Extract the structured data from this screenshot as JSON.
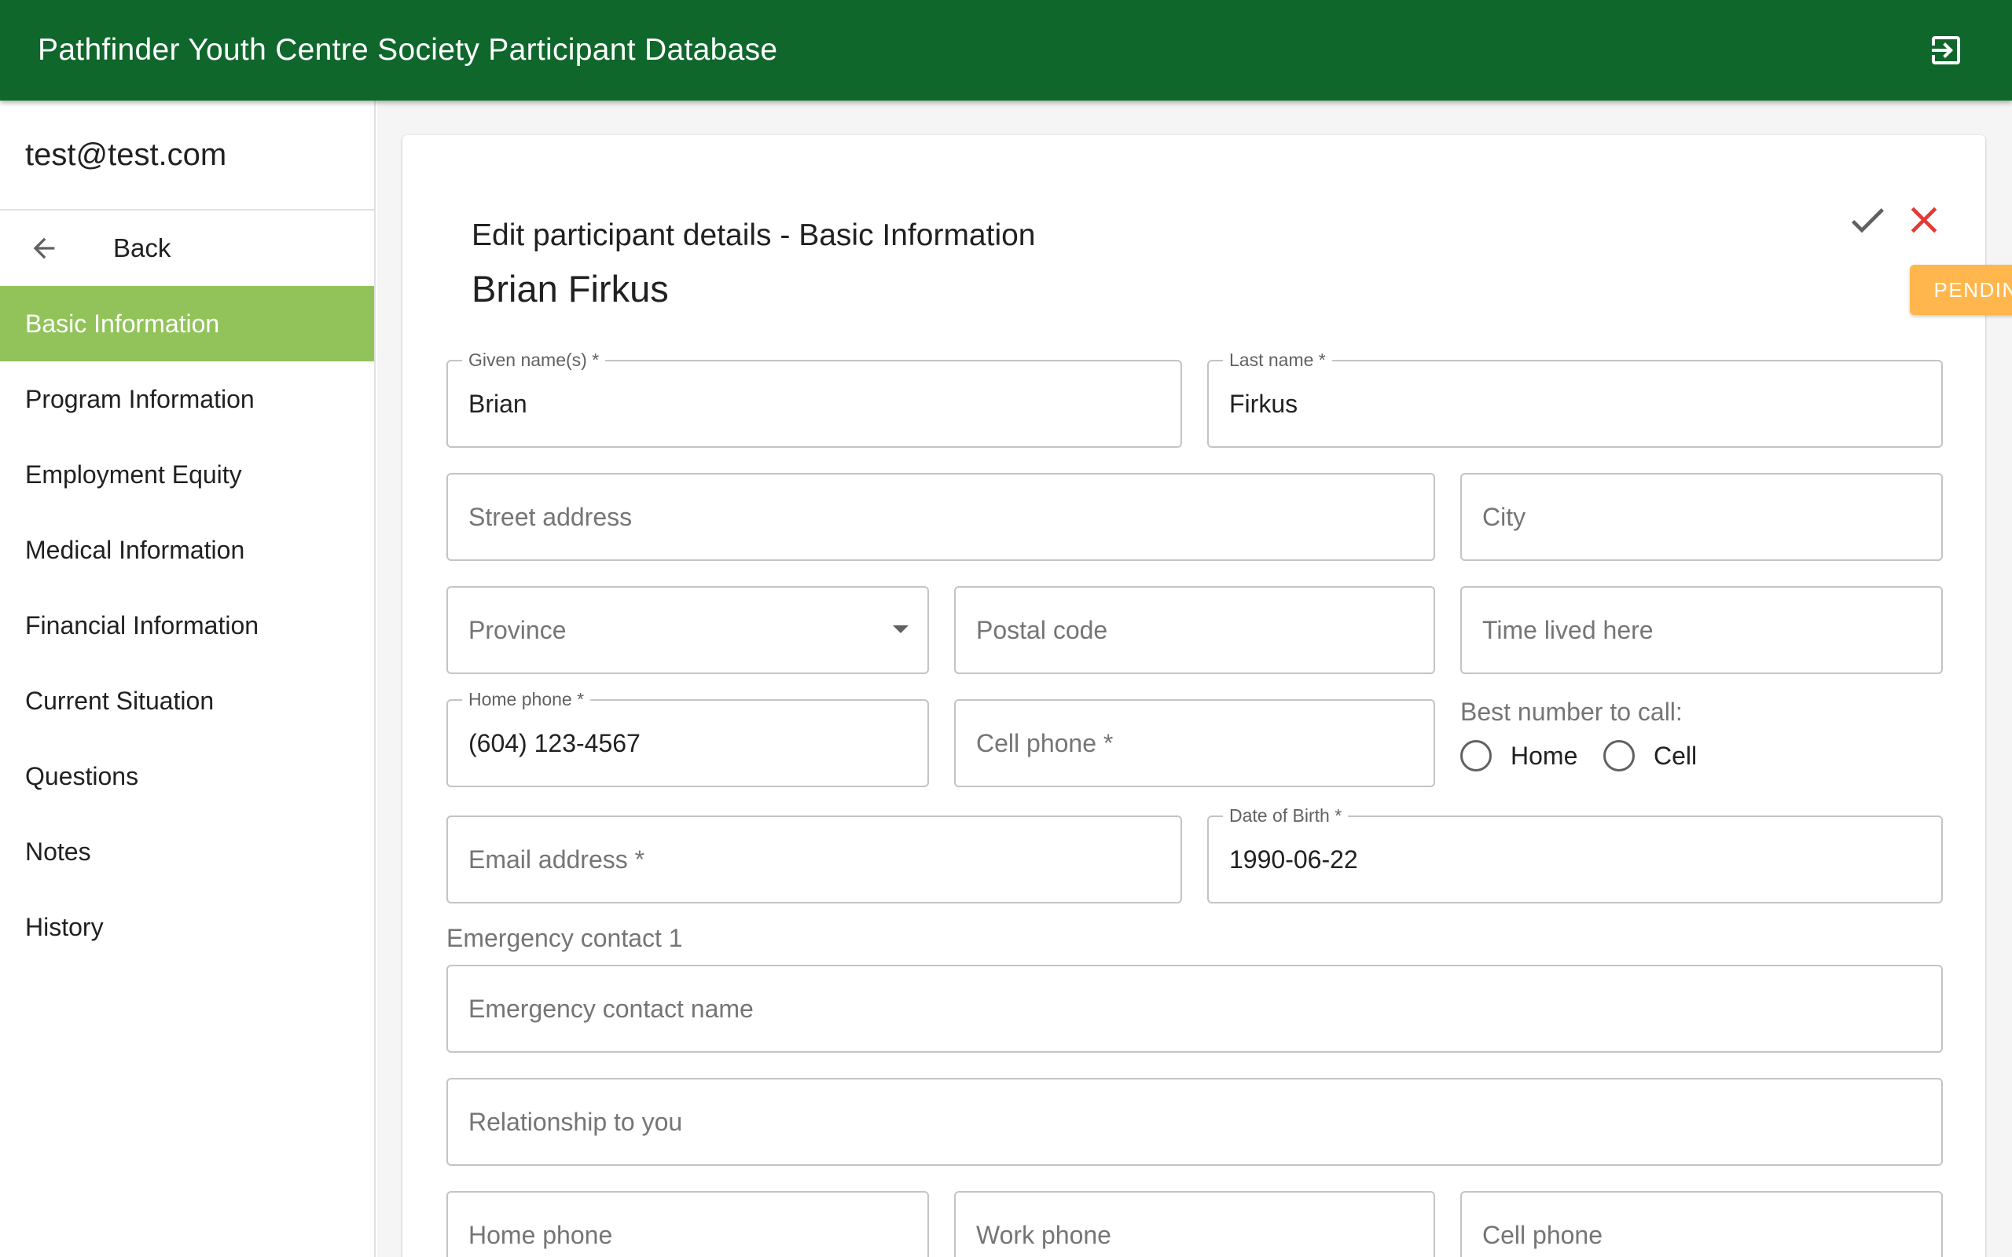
{
  "app": {
    "title": "Pathfinder Youth Centre Society Participant Database",
    "exit_icon": "exit-to-app-icon",
    "brand_color": "#0f672c"
  },
  "sidebar": {
    "user_email": "test@test.com",
    "back_label": "Back",
    "active_color": "#92c35a",
    "items": [
      {
        "label": "Basic Information",
        "active": true
      },
      {
        "label": "Program Information"
      },
      {
        "label": "Employment Equity"
      },
      {
        "label": "Medical Information"
      },
      {
        "label": "Financial Information"
      },
      {
        "label": "Current Situation"
      },
      {
        "label": "Questions"
      },
      {
        "label": "Notes"
      },
      {
        "label": "History"
      }
    ]
  },
  "form": {
    "heading": "Edit participant details - Basic Information",
    "participant_name": "Brian Firkus",
    "status_badge": "PENDING",
    "status_color": "#ffb74d",
    "given_name": {
      "label": "Given name(s) *",
      "value": "Brian"
    },
    "last_name": {
      "label": "Last name *",
      "value": "Firkus"
    },
    "street_address": {
      "placeholder": "Street address"
    },
    "city": {
      "placeholder": "City"
    },
    "province": {
      "placeholder": "Province"
    },
    "postal_code": {
      "placeholder": "Postal code"
    },
    "time_lived_here": {
      "placeholder": "Time lived here"
    },
    "home_phone": {
      "label": "Home phone *",
      "value": "(604) 123-4567"
    },
    "cell_phone": {
      "placeholder": "Cell phone *"
    },
    "best_number": {
      "label": "Best number to call:",
      "options": [
        "Home",
        "Cell"
      ]
    },
    "email": {
      "placeholder": "Email address *"
    },
    "dob": {
      "label": "Date of Birth *",
      "value": "1990-06-22"
    },
    "emergency": {
      "section_label": "Emergency contact 1",
      "name_placeholder": "Emergency contact name",
      "relationship_placeholder": "Relationship to you",
      "home_phone_placeholder": "Home phone",
      "work_phone_placeholder": "Work phone",
      "cell_phone_placeholder": "Cell phone"
    }
  }
}
